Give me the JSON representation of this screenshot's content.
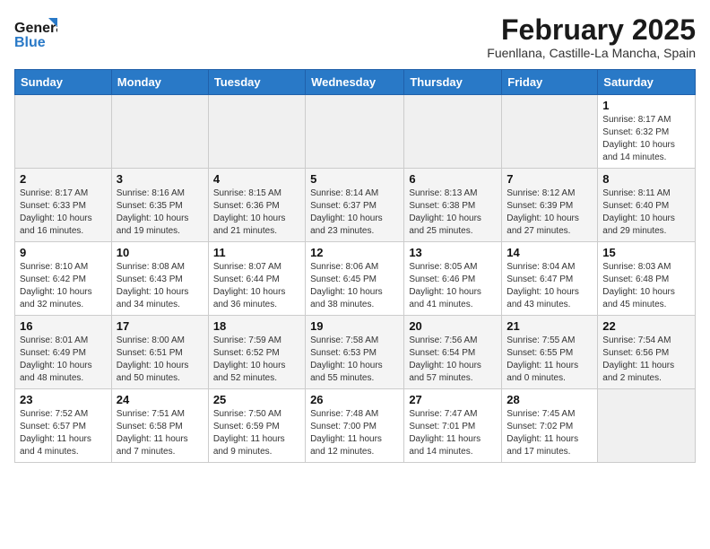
{
  "header": {
    "logo_general": "General",
    "logo_blue": "Blue",
    "title": "February 2025",
    "subtitle": "Fuenllana, Castille-La Mancha, Spain"
  },
  "weekdays": [
    "Sunday",
    "Monday",
    "Tuesday",
    "Wednesday",
    "Thursday",
    "Friday",
    "Saturday"
  ],
  "weeks": [
    [
      {
        "day": "",
        "info": ""
      },
      {
        "day": "",
        "info": ""
      },
      {
        "day": "",
        "info": ""
      },
      {
        "day": "",
        "info": ""
      },
      {
        "day": "",
        "info": ""
      },
      {
        "day": "",
        "info": ""
      },
      {
        "day": "1",
        "info": "Sunrise: 8:17 AM\nSunset: 6:32 PM\nDaylight: 10 hours\nand 14 minutes."
      }
    ],
    [
      {
        "day": "2",
        "info": "Sunrise: 8:17 AM\nSunset: 6:33 PM\nDaylight: 10 hours\nand 16 minutes."
      },
      {
        "day": "3",
        "info": "Sunrise: 8:16 AM\nSunset: 6:35 PM\nDaylight: 10 hours\nand 19 minutes."
      },
      {
        "day": "4",
        "info": "Sunrise: 8:15 AM\nSunset: 6:36 PM\nDaylight: 10 hours\nand 21 minutes."
      },
      {
        "day": "5",
        "info": "Sunrise: 8:14 AM\nSunset: 6:37 PM\nDaylight: 10 hours\nand 23 minutes."
      },
      {
        "day": "6",
        "info": "Sunrise: 8:13 AM\nSunset: 6:38 PM\nDaylight: 10 hours\nand 25 minutes."
      },
      {
        "day": "7",
        "info": "Sunrise: 8:12 AM\nSunset: 6:39 PM\nDaylight: 10 hours\nand 27 minutes."
      },
      {
        "day": "8",
        "info": "Sunrise: 8:11 AM\nSunset: 6:40 PM\nDaylight: 10 hours\nand 29 minutes."
      }
    ],
    [
      {
        "day": "9",
        "info": "Sunrise: 8:10 AM\nSunset: 6:42 PM\nDaylight: 10 hours\nand 32 minutes."
      },
      {
        "day": "10",
        "info": "Sunrise: 8:08 AM\nSunset: 6:43 PM\nDaylight: 10 hours\nand 34 minutes."
      },
      {
        "day": "11",
        "info": "Sunrise: 8:07 AM\nSunset: 6:44 PM\nDaylight: 10 hours\nand 36 minutes."
      },
      {
        "day": "12",
        "info": "Sunrise: 8:06 AM\nSunset: 6:45 PM\nDaylight: 10 hours\nand 38 minutes."
      },
      {
        "day": "13",
        "info": "Sunrise: 8:05 AM\nSunset: 6:46 PM\nDaylight: 10 hours\nand 41 minutes."
      },
      {
        "day": "14",
        "info": "Sunrise: 8:04 AM\nSunset: 6:47 PM\nDaylight: 10 hours\nand 43 minutes."
      },
      {
        "day": "15",
        "info": "Sunrise: 8:03 AM\nSunset: 6:48 PM\nDaylight: 10 hours\nand 45 minutes."
      }
    ],
    [
      {
        "day": "16",
        "info": "Sunrise: 8:01 AM\nSunset: 6:49 PM\nDaylight: 10 hours\nand 48 minutes."
      },
      {
        "day": "17",
        "info": "Sunrise: 8:00 AM\nSunset: 6:51 PM\nDaylight: 10 hours\nand 50 minutes."
      },
      {
        "day": "18",
        "info": "Sunrise: 7:59 AM\nSunset: 6:52 PM\nDaylight: 10 hours\nand 52 minutes."
      },
      {
        "day": "19",
        "info": "Sunrise: 7:58 AM\nSunset: 6:53 PM\nDaylight: 10 hours\nand 55 minutes."
      },
      {
        "day": "20",
        "info": "Sunrise: 7:56 AM\nSunset: 6:54 PM\nDaylight: 10 hours\nand 57 minutes."
      },
      {
        "day": "21",
        "info": "Sunrise: 7:55 AM\nSunset: 6:55 PM\nDaylight: 11 hours\nand 0 minutes."
      },
      {
        "day": "22",
        "info": "Sunrise: 7:54 AM\nSunset: 6:56 PM\nDaylight: 11 hours\nand 2 minutes."
      }
    ],
    [
      {
        "day": "23",
        "info": "Sunrise: 7:52 AM\nSunset: 6:57 PM\nDaylight: 11 hours\nand 4 minutes."
      },
      {
        "day": "24",
        "info": "Sunrise: 7:51 AM\nSunset: 6:58 PM\nDaylight: 11 hours\nand 7 minutes."
      },
      {
        "day": "25",
        "info": "Sunrise: 7:50 AM\nSunset: 6:59 PM\nDaylight: 11 hours\nand 9 minutes."
      },
      {
        "day": "26",
        "info": "Sunrise: 7:48 AM\nSunset: 7:00 PM\nDaylight: 11 hours\nand 12 minutes."
      },
      {
        "day": "27",
        "info": "Sunrise: 7:47 AM\nSunset: 7:01 PM\nDaylight: 11 hours\nand 14 minutes."
      },
      {
        "day": "28",
        "info": "Sunrise: 7:45 AM\nSunset: 7:02 PM\nDaylight: 11 hours\nand 17 minutes."
      },
      {
        "day": "",
        "info": ""
      }
    ]
  ]
}
